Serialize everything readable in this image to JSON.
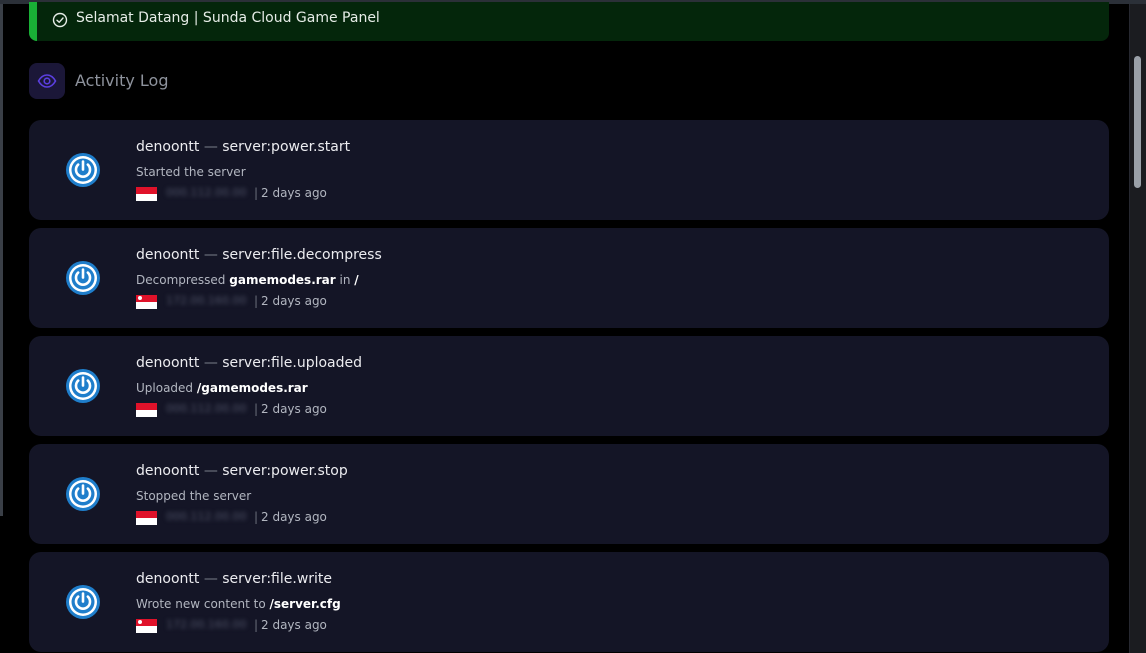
{
  "alert": {
    "icon": "check-circle-icon",
    "text": "Selamat Datang | Sunda Cloud Game Panel",
    "accent_color": "#19b036"
  },
  "section": {
    "icon": "eye-icon",
    "title": "Activity Log",
    "accent_color": "#5b3fe0"
  },
  "entries": [
    {
      "user": "denoontt",
      "separator": "—",
      "event": "server:power.start",
      "desc_parts": [
        {
          "text": "Started the server",
          "bold": false
        }
      ],
      "flag": "indonesia",
      "time_sep": "|",
      "time": "2 days ago",
      "icon": "power-icon"
    },
    {
      "user": "denoontt",
      "separator": "—",
      "event": "server:file.decompress",
      "desc_parts": [
        {
          "text": "Decompressed ",
          "bold": false
        },
        {
          "text": "gamemodes.rar",
          "bold": true
        },
        {
          "text": " in ",
          "bold": false
        },
        {
          "text": "/",
          "bold": true
        }
      ],
      "flag": "singapore",
      "time_sep": "|",
      "time": "2 days ago",
      "icon": "power-icon"
    },
    {
      "user": "denoontt",
      "separator": "—",
      "event": "server:file.uploaded",
      "desc_parts": [
        {
          "text": "Uploaded ",
          "bold": false
        },
        {
          "text": "/gamemodes.rar",
          "bold": true
        }
      ],
      "flag": "indonesia",
      "time_sep": "|",
      "time": "2 days ago",
      "icon": "power-icon"
    },
    {
      "user": "denoontt",
      "separator": "—",
      "event": "server:power.stop",
      "desc_parts": [
        {
          "text": "Stopped the server",
          "bold": false
        }
      ],
      "flag": "indonesia",
      "time_sep": "|",
      "time": "2 days ago",
      "icon": "power-icon"
    },
    {
      "user": "denoontt",
      "separator": "—",
      "event": "server:file.write",
      "desc_parts": [
        {
          "text": "Wrote new content to ",
          "bold": false
        },
        {
          "text": "/server.cfg",
          "bold": true
        }
      ],
      "flag": "singapore",
      "time_sep": "|",
      "time": "2 days ago",
      "icon": "power-icon"
    }
  ],
  "colors": {
    "background": "#000000",
    "card": "#141526",
    "power_icon": "#1f7ecb"
  }
}
